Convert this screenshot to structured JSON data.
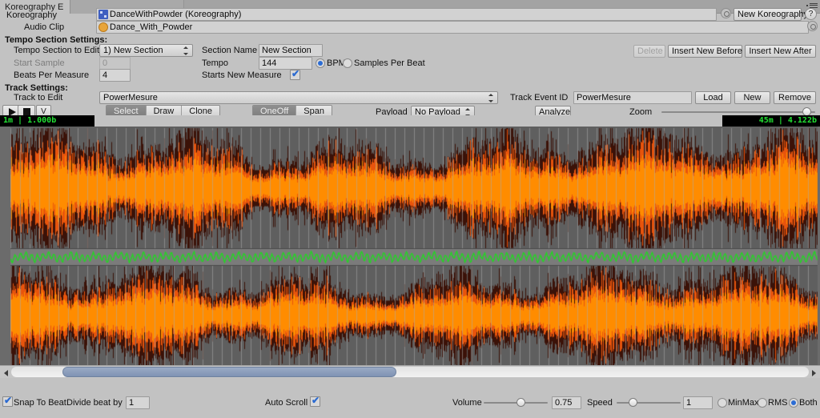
{
  "window": {
    "tab_title": "Koreography E",
    "menu_icon": "window-menu-icon"
  },
  "header": {
    "koreography_label": "Koreography",
    "koreography_value": "DanceWithPowder (Koreography)",
    "koreography_icon": "scriptable-object-icon",
    "new_koreography_button": "New Koreography",
    "help_button": "?",
    "audio_clip_label": "Audio Clip",
    "audio_clip_value": "Dance_With_Powder",
    "audio_clip_icon": "audio-clip-icon",
    "object_picker_icon": "object-picker-icon"
  },
  "tempo_section": {
    "heading": "Tempo Section Settings:",
    "tempo_section_to_edit_label": "Tempo Section to Edit",
    "tempo_section_to_edit_value": "1) New Section",
    "section_name_label": "Section Name",
    "section_name_value": "New Section",
    "start_sample_label": "Start Sample",
    "start_sample_value": "0",
    "tempo_label": "Tempo",
    "tempo_value": "144",
    "bpm_label": "BPM",
    "samples_per_beat_label": "Samples Per Beat",
    "tempo_mode_selected": "BPM",
    "beats_per_measure_label": "Beats Per Measure",
    "beats_per_measure_value": "4",
    "starts_new_measure_label": "Starts New Measure",
    "starts_new_measure_checked": true,
    "delete_button": "Delete",
    "delete_disabled": true,
    "insert_new_before_button": "Insert New Before",
    "insert_new_after_button": "Insert New After"
  },
  "track_section": {
    "heading": "Track Settings:",
    "track_to_edit_label": "Track to Edit",
    "track_to_edit_value": "PowerMesure",
    "track_event_id_label": "Track Event ID",
    "track_event_id_value": "PowerMesure",
    "load_button": "Load",
    "new_button": "New",
    "remove_button": "Remove",
    "analyze_button": "Analyze",
    "zoom_label": "Zoom",
    "zoom_value": 97
  },
  "toolbar": {
    "play_icon": "play-icon",
    "stop_icon": "stop-icon",
    "dropdown_button": "V",
    "edit_modes": [
      "Select",
      "Draw",
      "Clone"
    ],
    "edit_mode_selected": "Select",
    "event_types": [
      "OneOff",
      "Span"
    ],
    "event_type_selected": "OneOff",
    "payload_label": "Payload",
    "payload_value": "No Payload"
  },
  "waveform": {
    "time_left": "1m  |  1.000b",
    "time_right": "45m  |  4.122b",
    "colors": {
      "background": "#5f5f5f",
      "minmax": "#3b1208",
      "rms": "#ff8c00",
      "peak": "#e8540c",
      "grid": "#9a9a9a",
      "event_curve": "#21d821"
    },
    "scroll_thumb_start_pct": 7.6,
    "scroll_thumb_end_pct": 48.3
  },
  "bottom_bar": {
    "snap_to_beat_label": "Snap To Beat",
    "snap_to_beat_checked": true,
    "divide_beat_by_label": "Divide beat by",
    "divide_beat_by_value": "1",
    "auto_scroll_label": "Auto Scroll",
    "auto_scroll_checked": true,
    "volume_label": "Volume",
    "volume_value": "0.75",
    "volume_pct": 60,
    "speed_label": "Speed",
    "speed_value": "1",
    "speed_pct": 22,
    "display_modes": [
      "MinMax",
      "RMS",
      "Both"
    ],
    "display_mode_selected": "Both"
  }
}
